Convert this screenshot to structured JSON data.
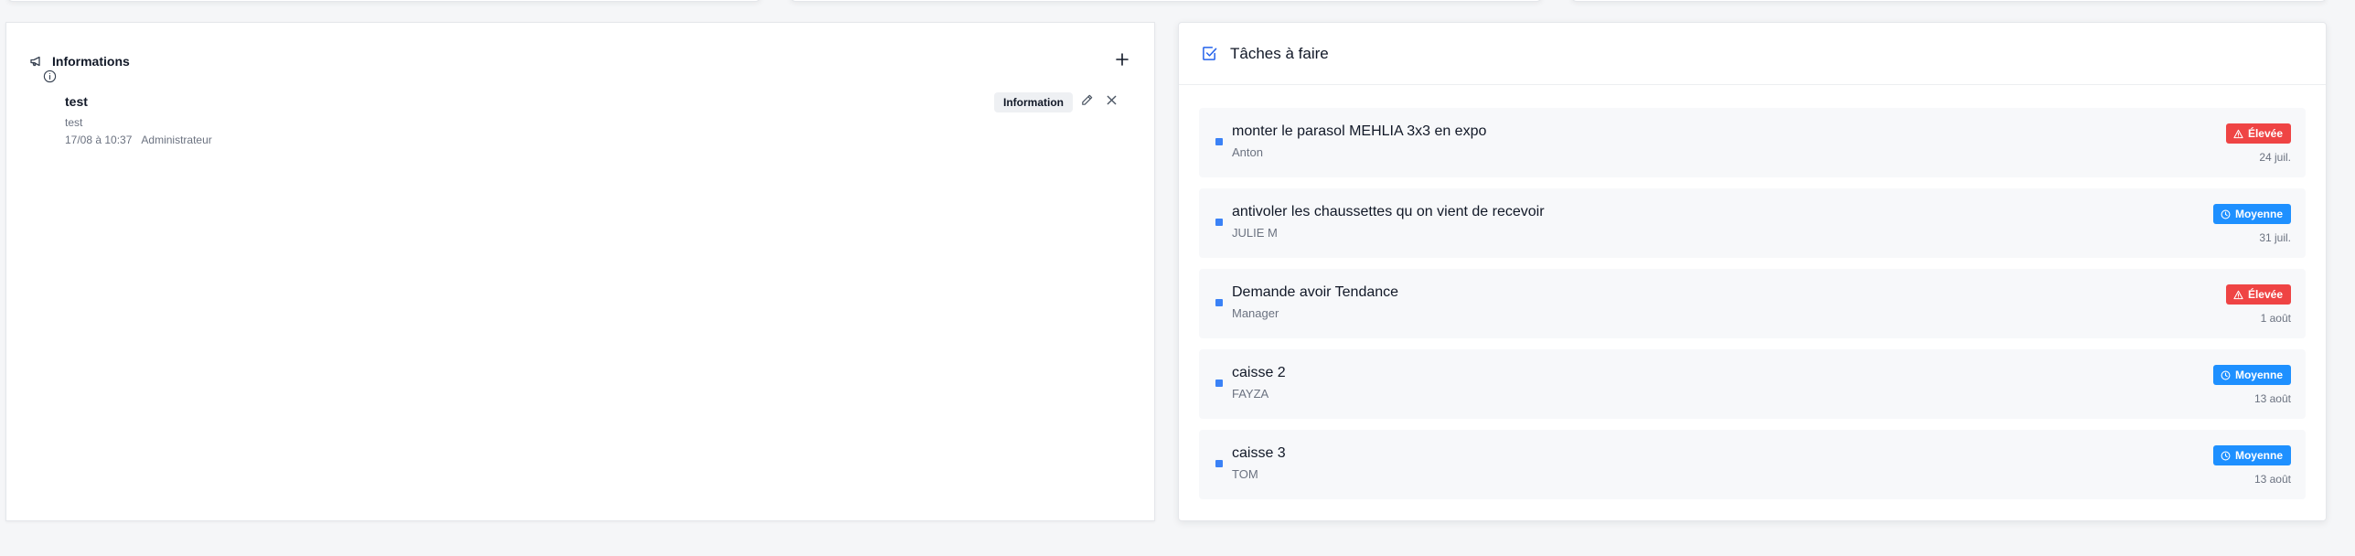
{
  "informations": {
    "title": "Informations",
    "items": [
      {
        "title": "test",
        "description": "test",
        "date": "17/08 à 10:37",
        "author": "Administrateur",
        "badge": "Information"
      }
    ]
  },
  "tasks": {
    "title": "Tâches à faire",
    "items": [
      {
        "title": "monter le parasol MEHLIA 3x3 en expo",
        "assignee": "Anton",
        "priority": "Élevée",
        "priority_level": "high",
        "due": "24 juil."
      },
      {
        "title": "antivoler les chaussettes qu on vient de recevoir",
        "assignee": "JULIE M",
        "priority": "Moyenne",
        "priority_level": "medium",
        "due": "31 juil."
      },
      {
        "title": "Demande avoir Tendance",
        "assignee": "Manager",
        "priority": "Élevée",
        "priority_level": "high",
        "due": "1 août"
      },
      {
        "title": "caisse 2",
        "assignee": "FAYZA",
        "priority": "Moyenne",
        "priority_level": "medium",
        "due": "13 août"
      },
      {
        "title": "caisse 3",
        "assignee": "TOM",
        "priority": "Moyenne",
        "priority_level": "medium",
        "due": "13 août"
      }
    ]
  },
  "colors": {
    "high": "#ef4444",
    "medium": "#1e90ff",
    "accent": "#2563eb",
    "dot": "#3b82f6"
  },
  "icons": {
    "informations": "megaphone-icon",
    "add": "plus-icon",
    "info_item": "info-circle-icon",
    "edit": "pencil-icon",
    "delete": "close-icon",
    "tasks": "checkbox-icon",
    "high": "warning-triangle-icon",
    "medium": "clock-icon"
  }
}
